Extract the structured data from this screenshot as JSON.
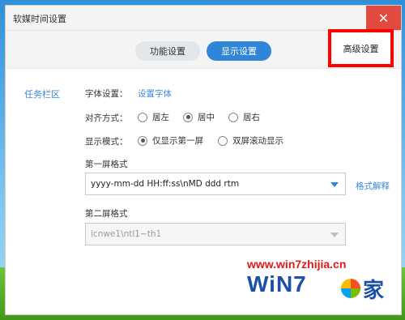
{
  "window": {
    "title": "软媒时间设置",
    "close_glyph": "✕"
  },
  "tabs": {
    "func_label": "功能设置",
    "display_label": "显示设置",
    "advanced_label": "高级设置"
  },
  "side": {
    "label": "任务栏区"
  },
  "font_row": {
    "label": "字体设置：",
    "link": "设置字体"
  },
  "align_row": {
    "label": "对齐方式：",
    "options": [
      "居左",
      "居中",
      "居右"
    ],
    "selected": "居中"
  },
  "display_mode_row": {
    "label": "显示模式：",
    "options": [
      "仅显示第一屏",
      "双屏滚动显示"
    ],
    "selected": "仅显示第一屏"
  },
  "first_screen": {
    "label": "第一屏格式",
    "value": "yyyy-mm-dd  HH:ff:ss\\nMD ddd rtm",
    "help_link": "格式解释"
  },
  "second_screen": {
    "label": "第二屏格式",
    "value": "icnwe1\\ntl1~th1"
  },
  "watermark": {
    "url": "www.win7zhijia.cn",
    "logo_text": "WiN7",
    "logo_suffix": "家"
  }
}
